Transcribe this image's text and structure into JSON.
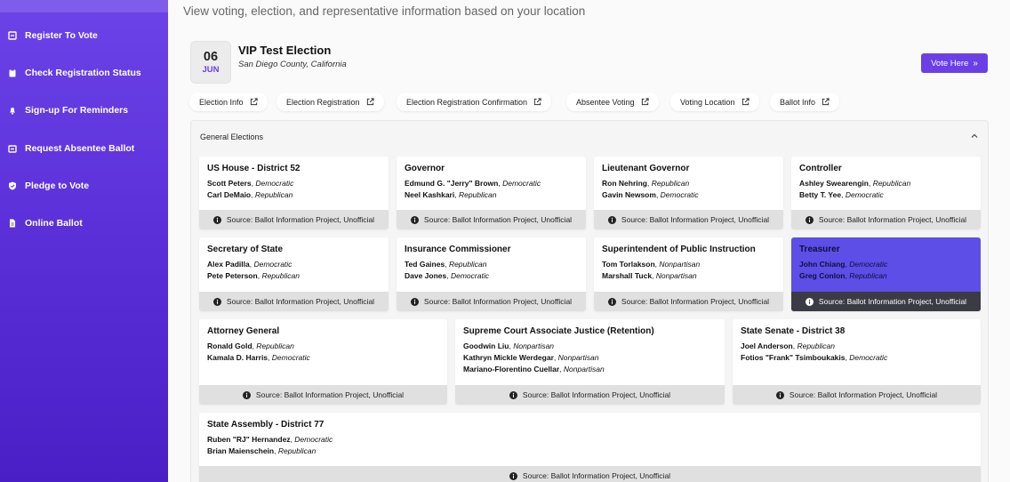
{
  "sidebar": {
    "items": [
      {
        "label": "Register To Vote",
        "icon": "register-icon"
      },
      {
        "label": "Check Registration Status",
        "icon": "clipboard-icon"
      },
      {
        "label": "Sign-up For Reminders",
        "icon": "bell-icon"
      },
      {
        "label": "Request Absentee Ballot",
        "icon": "mailbox-icon"
      },
      {
        "label": "Pledge to Vote",
        "icon": "shield-check-icon"
      },
      {
        "label": "Online Ballot",
        "icon": "document-icon"
      }
    ]
  },
  "header": {
    "subtitle": "View voting, election, and representative information based on your location"
  },
  "election": {
    "day": "06",
    "month": "JUN",
    "title": "VIP Test Election",
    "location": "San Diego County, California",
    "vote_label": "Vote Here"
  },
  "links": [
    "Election Info",
    "Election Registration",
    "Election Registration Confirmation",
    "Absentee Voting",
    "Voting Location",
    "Ballot Info"
  ],
  "panel": {
    "heading": "General Elections"
  },
  "source_text": "Source: Ballot Information Project, Unofficial",
  "contests": [
    {
      "title": "US House - District 52",
      "candidates": [
        {
          "name": "Scott Peters",
          "party": "Democratic"
        },
        {
          "name": "Carl DeMaio",
          "party": "Republican"
        }
      ]
    },
    {
      "title": "Governor",
      "candidates": [
        {
          "name": "Edmund G. \"Jerry\" Brown",
          "party": "Democratic"
        },
        {
          "name": "Neel Kashkari",
          "party": "Republican"
        }
      ]
    },
    {
      "title": "Lieutenant Governor",
      "candidates": [
        {
          "name": "Ron Nehring",
          "party": "Republican"
        },
        {
          "name": "Gavin Newsom",
          "party": "Democratic"
        }
      ]
    },
    {
      "title": "Controller",
      "candidates": [
        {
          "name": "Ashley Swearengin",
          "party": "Republican"
        },
        {
          "name": "Betty T. Yee",
          "party": "Democratic"
        }
      ]
    },
    {
      "title": "Secretary of State",
      "candidates": [
        {
          "name": "Alex Padilla",
          "party": "Democratic"
        },
        {
          "name": "Pete Peterson",
          "party": "Republican"
        }
      ]
    },
    {
      "title": "Insurance Commissioner",
      "candidates": [
        {
          "name": "Ted Gaines",
          "party": "Republican"
        },
        {
          "name": "Dave Jones",
          "party": "Democratic"
        }
      ]
    },
    {
      "title": "Superintendent of Public Instruction",
      "candidates": [
        {
          "name": "Tom Torlakson",
          "party": "Nonpartisan"
        },
        {
          "name": "Marshall Tuck",
          "party": "Nonpartisan"
        }
      ]
    },
    {
      "title": "Treasurer",
      "candidates": [
        {
          "name": "John Chiang",
          "party": "Democratic"
        },
        {
          "name": "Greg Conlon",
          "party": "Republican"
        }
      ]
    },
    {
      "title": "Attorney General",
      "candidates": [
        {
          "name": "Ronald Gold",
          "party": "Republican"
        },
        {
          "name": "Kamala D. Harris",
          "party": "Democratic"
        }
      ]
    },
    {
      "title": "Supreme Court Associate Justice (Retention)",
      "candidates": [
        {
          "name": "Goodwin Liu",
          "party": "Nonpartisan"
        },
        {
          "name": "Kathryn Mickle Werdegar",
          "party": "Nonpartisan"
        },
        {
          "name": "Mariano-Florentino Cuellar",
          "party": "Nonpartisan"
        }
      ]
    },
    {
      "title": "State Senate - District 38",
      "candidates": [
        {
          "name": "Joel Anderson",
          "party": "Republican"
        },
        {
          "name": "Fotios \"Frank\" Tsimboukakis",
          "party": "Democratic"
        }
      ]
    },
    {
      "title": "State Assembly - District 77",
      "candidates": [
        {
          "name": "Ruben \"RJ\" Hernandez",
          "party": "Democratic"
        },
        {
          "name": "Brian Maienschein",
          "party": "Republican"
        }
      ]
    }
  ],
  "colors": {
    "accent": "#6b3fe6",
    "highlight": "#5c4ee6"
  }
}
